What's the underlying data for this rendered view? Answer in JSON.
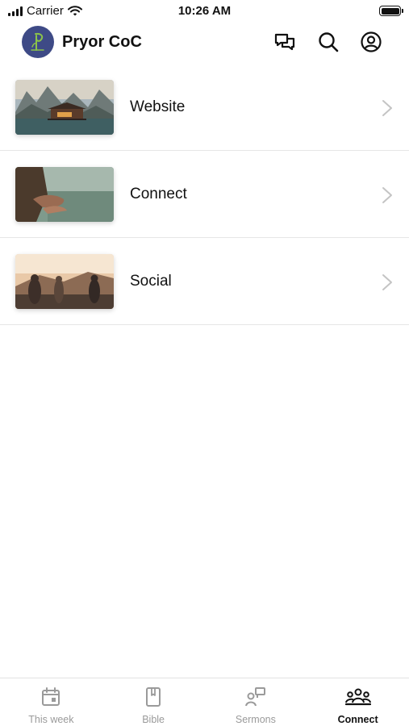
{
  "status_bar": {
    "carrier": "Carrier",
    "time": "10:26 AM"
  },
  "header": {
    "title": "Pryor CoC"
  },
  "items": [
    {
      "label": "Website"
    },
    {
      "label": "Connect"
    },
    {
      "label": "Social"
    }
  ],
  "tabs": [
    {
      "label": "This week",
      "icon": "calendar-icon"
    },
    {
      "label": "Bible",
      "icon": "bible-icon"
    },
    {
      "label": "Sermons",
      "icon": "sermons-icon"
    },
    {
      "label": "Connect",
      "icon": "people-icon",
      "active": true
    }
  ],
  "colors": {
    "accent": "#111111",
    "inactive": "#9a9a9a",
    "avatar_bg": "#3e4a86",
    "logo_green": "#8bc34a"
  }
}
